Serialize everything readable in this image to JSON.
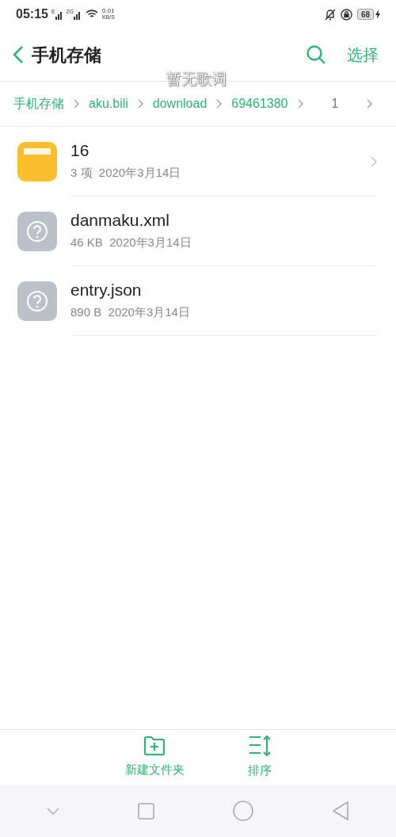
{
  "status_bar": {
    "time": "05:15",
    "sim1_label": "E",
    "sim2_label": "2G",
    "speed_value": "0.01",
    "speed_unit": "KB/S",
    "battery": "68"
  },
  "header": {
    "title": "手机存储",
    "action": "选择"
  },
  "lyrics_overlay": "暂无歌词",
  "breadcrumb": [
    {
      "label": "手机存储",
      "selected": false
    },
    {
      "label": "aku.bili",
      "selected": false
    },
    {
      "label": "download",
      "selected": false
    },
    {
      "label": "69461380",
      "selected": false
    },
    {
      "label": "1",
      "selected": true
    }
  ],
  "files": [
    {
      "kind": "folder",
      "name": "16",
      "meta": "3 项  2020年3月14日"
    },
    {
      "kind": "unknown",
      "name": "danmaku.xml",
      "meta": "46 KB  2020年3月14日"
    },
    {
      "kind": "unknown",
      "name": "entry.json",
      "meta": "890 B  2020年3月14日"
    }
  ],
  "bottom_actions": [
    {
      "kind": "new-folder",
      "label": "新建文件夹"
    },
    {
      "kind": "sort",
      "label": "排序"
    }
  ]
}
